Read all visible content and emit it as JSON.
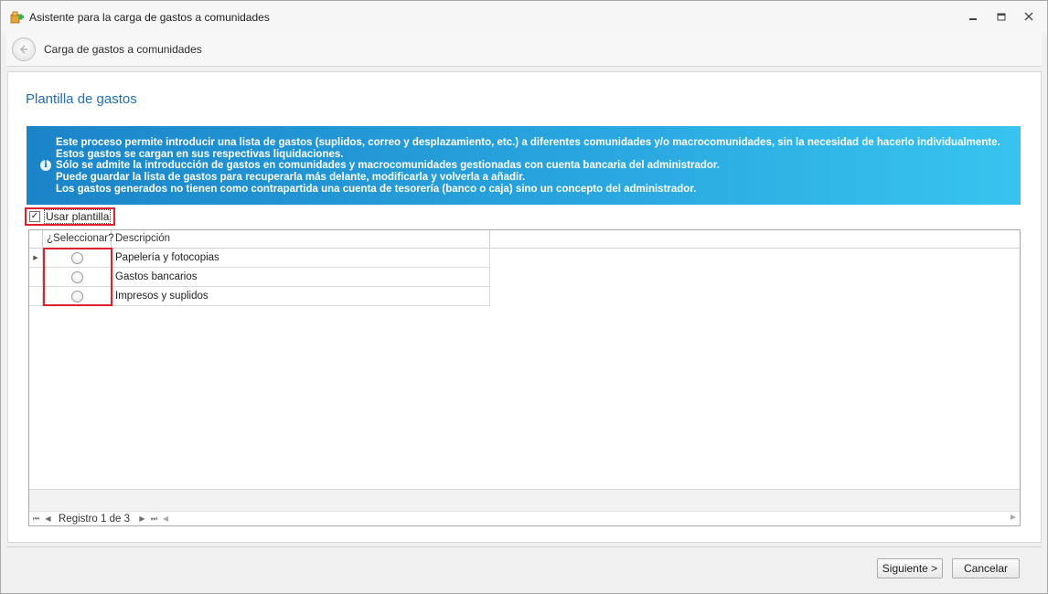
{
  "window": {
    "title": "Asistente para la carga de gastos a comunidades",
    "minimize_glyph": "🗕",
    "maximize_glyph": "🗖",
    "close_glyph": "✕"
  },
  "header": {
    "title": "Carga de gastos a comunidades"
  },
  "page": {
    "title": "Plantilla de gastos"
  },
  "info": {
    "icon_glyph": "i",
    "lines": [
      "Este proceso permite introducir una lista de gastos (suplidos, correo y desplazamiento, etc.) a diferentes comunidades y/o macrocomunidades, sin la necesidad de hacerlo individualmente. Estos gastos se cargan en sus respectivas liquidaciones.",
      "Sólo se admite la introducción de gastos en comunidades y macrocomunidades gestionadas con cuenta bancaria del administrador.",
      "Puede guardar la lista de gastos para recuperarla más delante, modificarla y volverla a añadir.",
      "Los gastos generados no tienen como contrapartida una cuenta de tesorería (banco o caja) sino un concepto del administrador."
    ]
  },
  "use_template": {
    "label": "Usar plantilla",
    "checked": true,
    "check_glyph": "✓"
  },
  "grid": {
    "columns": [
      "¿Seleccionar?",
      "Descripción"
    ],
    "rows": [
      {
        "description": "Papelería y fotocopias",
        "selected": false
      },
      {
        "description": "Gastos bancarios",
        "selected": false
      },
      {
        "description": "Impresos y suplidos",
        "selected": false
      }
    ],
    "current_row_glyph": "▶"
  },
  "navigator": {
    "first_glyph": "⏮",
    "prev_glyph": "◀",
    "next_glyph": "▶",
    "last_glyph": "⏭",
    "record_text": "Registro 1 de 3",
    "scroll_left_glyph": "◀",
    "scroll_right_glyph": "▶"
  },
  "footer": {
    "next_label": "Siguiente >",
    "cancel_label": "Cancelar"
  },
  "colors": {
    "accent_title": "#1d6fb8",
    "banner_start": "#1b84c8",
    "banner_end": "#38c4ef",
    "highlight": "#e0202a"
  }
}
